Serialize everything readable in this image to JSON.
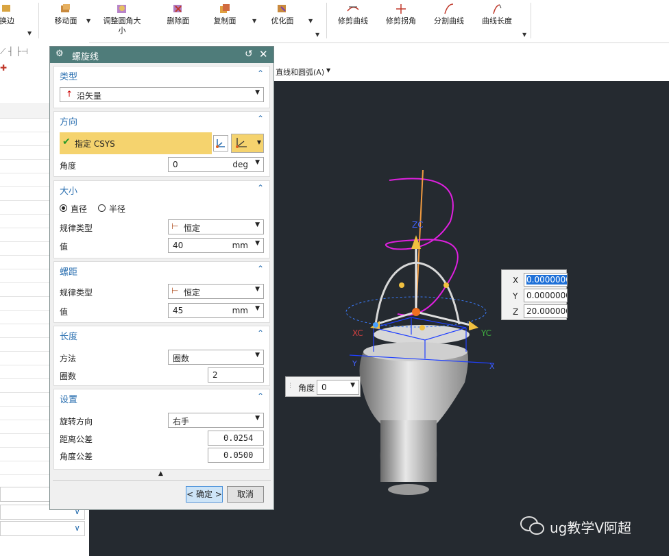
{
  "ribbon": {
    "items": [
      {
        "label": "换边",
        "icon": "swap-edge-icon"
      },
      {
        "label": "移动面",
        "icon": "move-face-icon"
      },
      {
        "label": "调整圆角大",
        "label2": "小",
        "icon": "resize-blend-icon"
      },
      {
        "label": "删除面",
        "icon": "delete-face-icon"
      },
      {
        "label": "复制面",
        "icon": "copy-face-icon"
      },
      {
        "label": "优化面",
        "icon": "optimize-face-icon"
      },
      {
        "label": "修剪曲线",
        "icon": "trim-curve-icon"
      },
      {
        "label": "修剪拐角",
        "icon": "trim-corner-icon"
      },
      {
        "label": "分割曲线",
        "icon": "divide-curve-icon"
      },
      {
        "label": "曲线长度",
        "icon": "curve-length-icon"
      }
    ]
  },
  "viewport_toolbar": {
    "menu_label": "直线和圆弧(A)"
  },
  "dialog": {
    "title": "螺旋线",
    "sections": {
      "type": {
        "header": "类型",
        "value": "沿矢量"
      },
      "direction": {
        "header": "方向",
        "specify_label": "指定 CSYS",
        "angle_label": "角度",
        "angle_value": "0",
        "angle_unit": "deg"
      },
      "size": {
        "header": "大小",
        "radio_diameter": "直径",
        "radio_radius": "半径",
        "selected": "直径",
        "law_label": "规律类型",
        "law_value": "恒定",
        "value_label": "值",
        "value": "40",
        "unit": "mm"
      },
      "pitch": {
        "header": "螺距",
        "law_label": "规律类型",
        "law_value": "恒定",
        "value_label": "值",
        "value": "45",
        "unit": "mm"
      },
      "length": {
        "header": "长度",
        "method_label": "方法",
        "method_value": "圈数",
        "turns_label": "圈数",
        "turns_value": "2"
      },
      "settings": {
        "header": "设置",
        "rotation_label": "旋转方向",
        "rotation_value": "右手",
        "dist_tol_label": "距离公差",
        "dist_tol_value": "0.0254",
        "angle_tol_label": "角度公差",
        "angle_tol_value": "0.0500"
      }
    },
    "ok_label": "< 确定 >",
    "cancel_label": "取消"
  },
  "coord_input": {
    "x_label": "X",
    "x_value": "0.0000000",
    "y_label": "Y",
    "y_value": "0.0000000",
    "z_label": "Z",
    "z_value": "20.000000"
  },
  "angle_input": {
    "label": "角度",
    "value": "0"
  },
  "axes": {
    "zc": "ZC",
    "xc": "XC",
    "yc": "YC",
    "x": "X",
    "y": "Y"
  },
  "watermark": "ug教学V阿超",
  "colors": {
    "dialog_title_bg": "#4f7c7a",
    "section_header": "#2a6fb0",
    "highlight": "#f5d36e",
    "viewport_bg": "#252a30",
    "helix": "#e020e0"
  }
}
